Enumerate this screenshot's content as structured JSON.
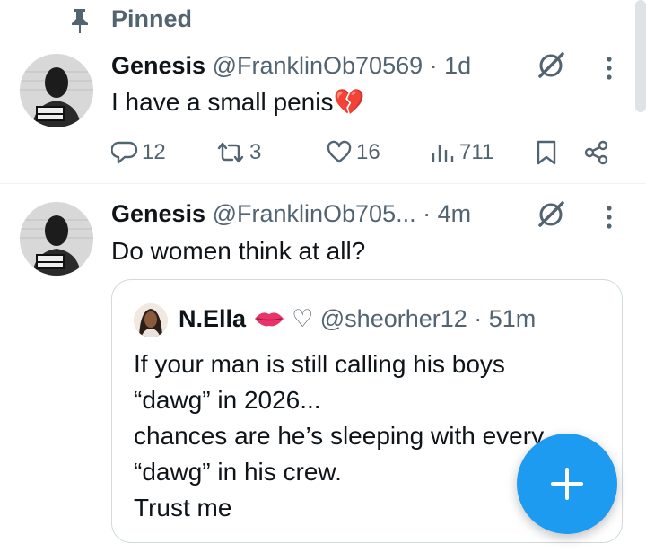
{
  "pinned": {
    "label": "Pinned",
    "icon": "pin-icon"
  },
  "tweets": [
    {
      "name": "Genesis",
      "handle": "@FranklinOb70569",
      "time": "· 1d",
      "text": "I have a small penis",
      "emoji": "💔",
      "replies": "12",
      "reposts": "3",
      "likes": "16",
      "views": "711"
    },
    {
      "name": "Genesis",
      "handle": "@FranklinOb705...",
      "time": "· 4m",
      "text": "Do women think at all?"
    }
  ],
  "quote": {
    "name": "N.Ella",
    "suffix": "♡ @sheorher12 · 51m",
    "lines": [
      "If your man is still calling his boys",
      "“dawg” in 2026...",
      "chances are he’s sleeping with every",
      "“dawg” in his crew.",
      "Trust me"
    ]
  },
  "colors": {
    "accent": "#1d9bf0",
    "secondary_text": "#536471",
    "heart_emoji": "#e0245e"
  },
  "icons": [
    "pin-icon",
    "grok-icon",
    "more-icon",
    "reply-icon",
    "repost-icon",
    "like-icon",
    "views-icon",
    "bookmark-icon",
    "share-icon",
    "lips-icon",
    "compose-plus-icon"
  ]
}
